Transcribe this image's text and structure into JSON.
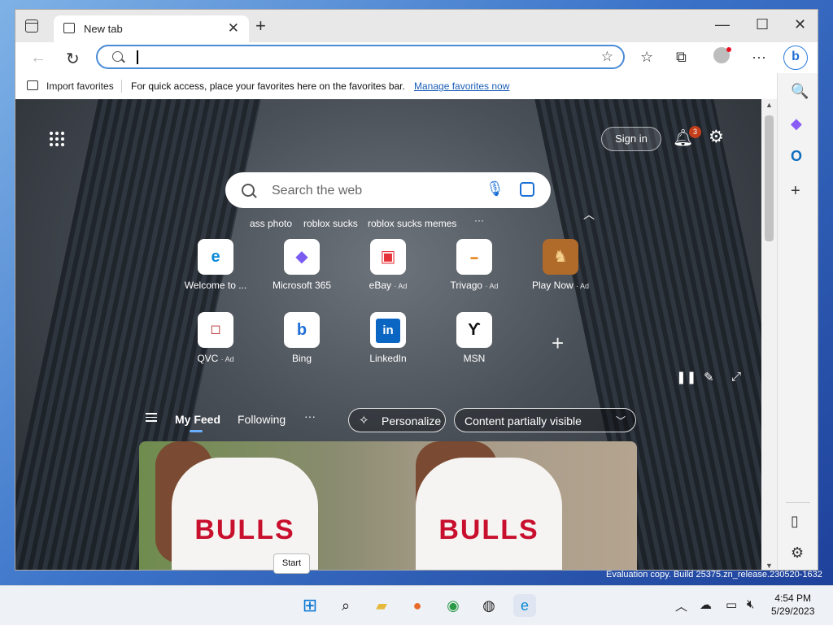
{
  "browser": {
    "tab": {
      "title": "New tab",
      "close": "✕"
    },
    "new_tab": "+",
    "window_controls": {
      "minimize": "—",
      "maximize": "☐",
      "close": "✕"
    },
    "address_bar": {
      "value": "",
      "placeholder": ""
    }
  },
  "favorites_bar": {
    "import_label": "Import favorites",
    "message": "For quick access, place your favorites here on the favorites bar.",
    "manage_link": "Manage favorites now"
  },
  "newtab": {
    "sign_in": "Sign in",
    "notification_count": "3",
    "search_placeholder": "Search the web",
    "trending": [
      "ass photo",
      "roblox sucks",
      "roblox sucks memes"
    ],
    "more": "···",
    "quick_links": [
      {
        "label": "Welcome to ...",
        "ad": ""
      },
      {
        "label": "Microsoft 365",
        "ad": ""
      },
      {
        "label": "eBay",
        "ad": "· Ad"
      },
      {
        "label": "Trivago",
        "ad": "· Ad"
      },
      {
        "label": "Play Now",
        "ad": "· Ad"
      },
      {
        "label": "QVC",
        "ad": "· Ad"
      },
      {
        "label": "Bing",
        "ad": ""
      },
      {
        "label": "LinkedIn",
        "ad": ""
      },
      {
        "label": "MSN",
        "ad": ""
      }
    ],
    "feed": {
      "my_feed": "My Feed",
      "following": "Following",
      "more": "···",
      "personalize": "Personalize",
      "content_visibility": "Content partially visible"
    },
    "hero_text": [
      "BULLS",
      "BULLS"
    ]
  },
  "tooltip": "Start",
  "watermark": "Evaluation copy. Build 25375.zn_release.230520-1632",
  "taskbar": {
    "time": "4:54 PM",
    "date": "5/29/2023"
  }
}
